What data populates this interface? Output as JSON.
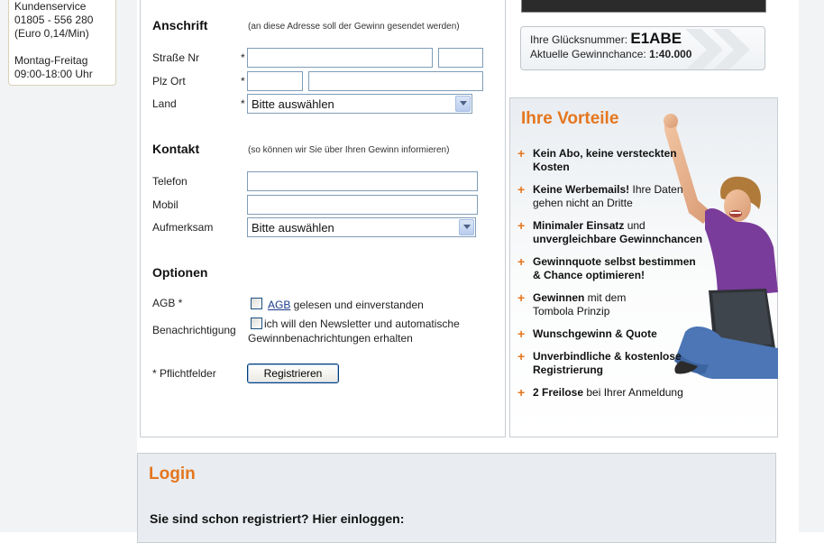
{
  "service": {
    "title": "Kundenservice",
    "phone": "01805 - 556 280",
    "price": "(Euro 0,14/Min)",
    "days": "Montag-Freitag",
    "hours": "09:00-18:00 Uhr"
  },
  "address": {
    "heading": "Anschrift",
    "hint": "(an diese Adresse soll der Gewinn gesendet werden)",
    "street_label": "Straße Nr",
    "zip_label": "Plz Ort",
    "country_label": "Land",
    "country_value": "Bitte auswählen",
    "required_mark": "*"
  },
  "contact": {
    "heading": "Kontakt",
    "hint": "(so können wir Sie über Ihren Gewinn informieren)",
    "phone_label": "Telefon",
    "mobile_label": "Mobil",
    "attention_label": "Aufmerksam",
    "attention_value": "Bitte auswählen"
  },
  "options": {
    "heading": "Optionen",
    "agb_label": "AGB *",
    "agb_link": "AGB",
    "agb_text": " gelesen und einverstanden",
    "notify_label": "Benachrichtigung",
    "notify_text": "ich will den Newsletter und automatische Gewinnbenachrichtungen erhalten",
    "agb_checked": false,
    "notify_checked": false
  },
  "form_footer": {
    "required_note": "* Pflichtfelder",
    "submit_label": "Registrieren"
  },
  "lucky": {
    "number_label": "Ihre Glücksnummer:",
    "number_value": "E1ABE",
    "chance_label": "Aktuelle Gewinnchance:",
    "chance_value": "1:40.000"
  },
  "advantages": {
    "title": "Ihre Vorteile",
    "items": [
      {
        "strong": "Kein Abo, keine versteckten Kosten",
        "rest": ""
      },
      {
        "strong": "Keine Werbemails!",
        "rest": " Ihre Daten gehen nicht an Dritte"
      },
      {
        "strong": "Minimaler Einsatz",
        "rest": " und ",
        "strong2": "unvergleichbare Gewinnchancen"
      },
      {
        "strong": "Gewinnquote selbst bestimmen & Chance optimieren!",
        "rest": ""
      },
      {
        "strong": "Gewinnen",
        "rest": " mit dem Tombola Prinzip"
      },
      {
        "strong": "Wunschgewinn & Quote",
        "rest": ""
      },
      {
        "strong": "Unverbindliche & kostenlose Registrierung",
        "rest": ""
      },
      {
        "strong": "2 Freilose",
        "rest": " bei Ihrer Anmeldung"
      }
    ]
  },
  "login": {
    "title": "Login",
    "subtitle": "Sie sind schon registriert? Hier einloggen:"
  },
  "colors": {
    "accent": "#e5761e",
    "panel_border": "#c8cdd2",
    "input_border": "#7f9db9"
  }
}
